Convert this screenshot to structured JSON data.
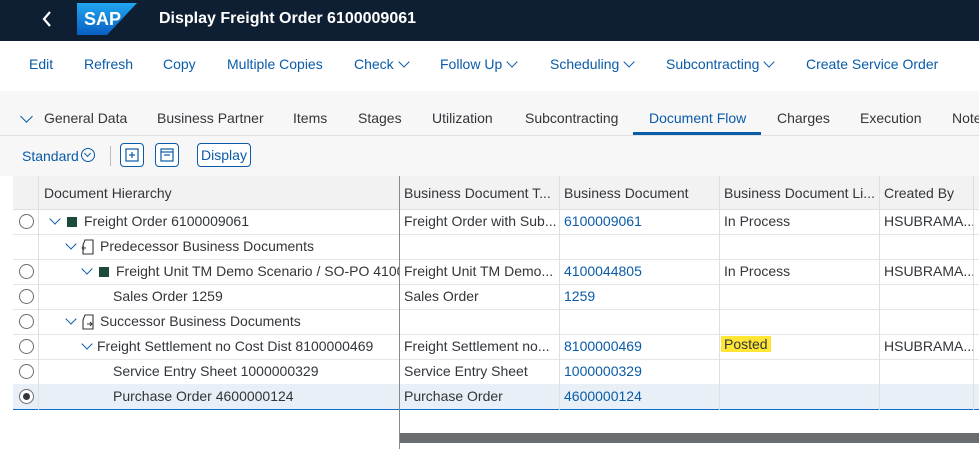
{
  "shell": {
    "back_icon": "back-chevron-icon",
    "logo_text": "SAP",
    "title": "Display Freight Order 6100009061"
  },
  "toolbar": {
    "edit": "Edit",
    "refresh": "Refresh",
    "copy": "Copy",
    "multiple_copies": "Multiple Copies",
    "check": "Check",
    "follow_up": "Follow Up",
    "scheduling": "Scheduling",
    "subcontracting": "Subcontracting",
    "create_service_order": "Create Service Order"
  },
  "tabs": [
    "General Data",
    "Business Partner",
    "Items",
    "Stages",
    "Utilization",
    "Subcontracting",
    "Document Flow",
    "Charges",
    "Execution",
    "Note"
  ],
  "active_tab": "Document Flow",
  "table_toolbar": {
    "variant": "Standard",
    "display_button": "Display"
  },
  "columns": [
    "Document Hierarchy",
    "Business Document T...",
    "Business Document",
    "Business Document Li...",
    "Created By"
  ],
  "rows": [
    {
      "hierarchy": "Freight Order 6100009061",
      "type": "Freight Order with Sub...",
      "doc": "6100009061",
      "status": "In Process",
      "created_by": "HSUBRAMA..."
    },
    {
      "hierarchy": "Predecessor Business Documents",
      "type": "",
      "doc": "",
      "status": "",
      "created_by": ""
    },
    {
      "hierarchy": "Freight Unit TM Demo Scenario / SO-PO 4100",
      "type": "Freight Unit TM Demo...",
      "doc": "4100044805",
      "status": "In Process",
      "created_by": "HSUBRAMA..."
    },
    {
      "hierarchy": "Sales Order 1259",
      "type": "Sales Order",
      "doc": "1259",
      "status": "",
      "created_by": ""
    },
    {
      "hierarchy": "Successor Business Documents",
      "type": "",
      "doc": "",
      "status": "",
      "created_by": ""
    },
    {
      "hierarchy": "Freight Settlement no Cost Dist 8100000469",
      "type": "Freight Settlement no...",
      "doc": "8100000469",
      "status": "Posted",
      "created_by": "HSUBRAMA..."
    },
    {
      "hierarchy": "Service Entry Sheet 1000000329",
      "type": "Service Entry Sheet",
      "doc": "1000000329",
      "status": "",
      "created_by": ""
    },
    {
      "hierarchy": "Purchase Order 4600000124",
      "type": "Purchase Order",
      "doc": "4600000124",
      "status": "",
      "created_by": ""
    }
  ],
  "selected_row": 7,
  "colors": {
    "shell": "#0f1f33",
    "accent": "#0a5ba8",
    "highlight": "#ffe534"
  }
}
